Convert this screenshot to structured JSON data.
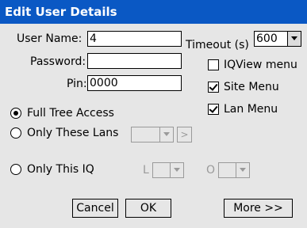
{
  "window": {
    "title": "Edit User Details"
  },
  "fields": {
    "user_name": {
      "label": "User Name:",
      "value": "4"
    },
    "password": {
      "label": "Password:",
      "value": ""
    },
    "pin": {
      "label": "Pin:",
      "value": "0000"
    },
    "timeout": {
      "label": "Timeout (s)",
      "value": "600"
    }
  },
  "checkboxes": [
    {
      "label": "IQView menu",
      "checked": false
    },
    {
      "label": "Site Menu",
      "checked": true
    },
    {
      "label": "Lan Menu",
      "checked": true
    }
  ],
  "access": {
    "full_tree": {
      "label": "Full Tree Access",
      "selected": true
    },
    "only_lans": {
      "label": "Only These Lans",
      "selected": false,
      "lan_select_value": "",
      "add_label": ">"
    },
    "only_iq": {
      "label": "Only This IQ",
      "selected": false,
      "l_label": "L",
      "l_value": "",
      "o_label": "O",
      "o_value": ""
    }
  },
  "buttons": {
    "cancel": "Cancel",
    "ok": "OK",
    "more": "More >>"
  }
}
